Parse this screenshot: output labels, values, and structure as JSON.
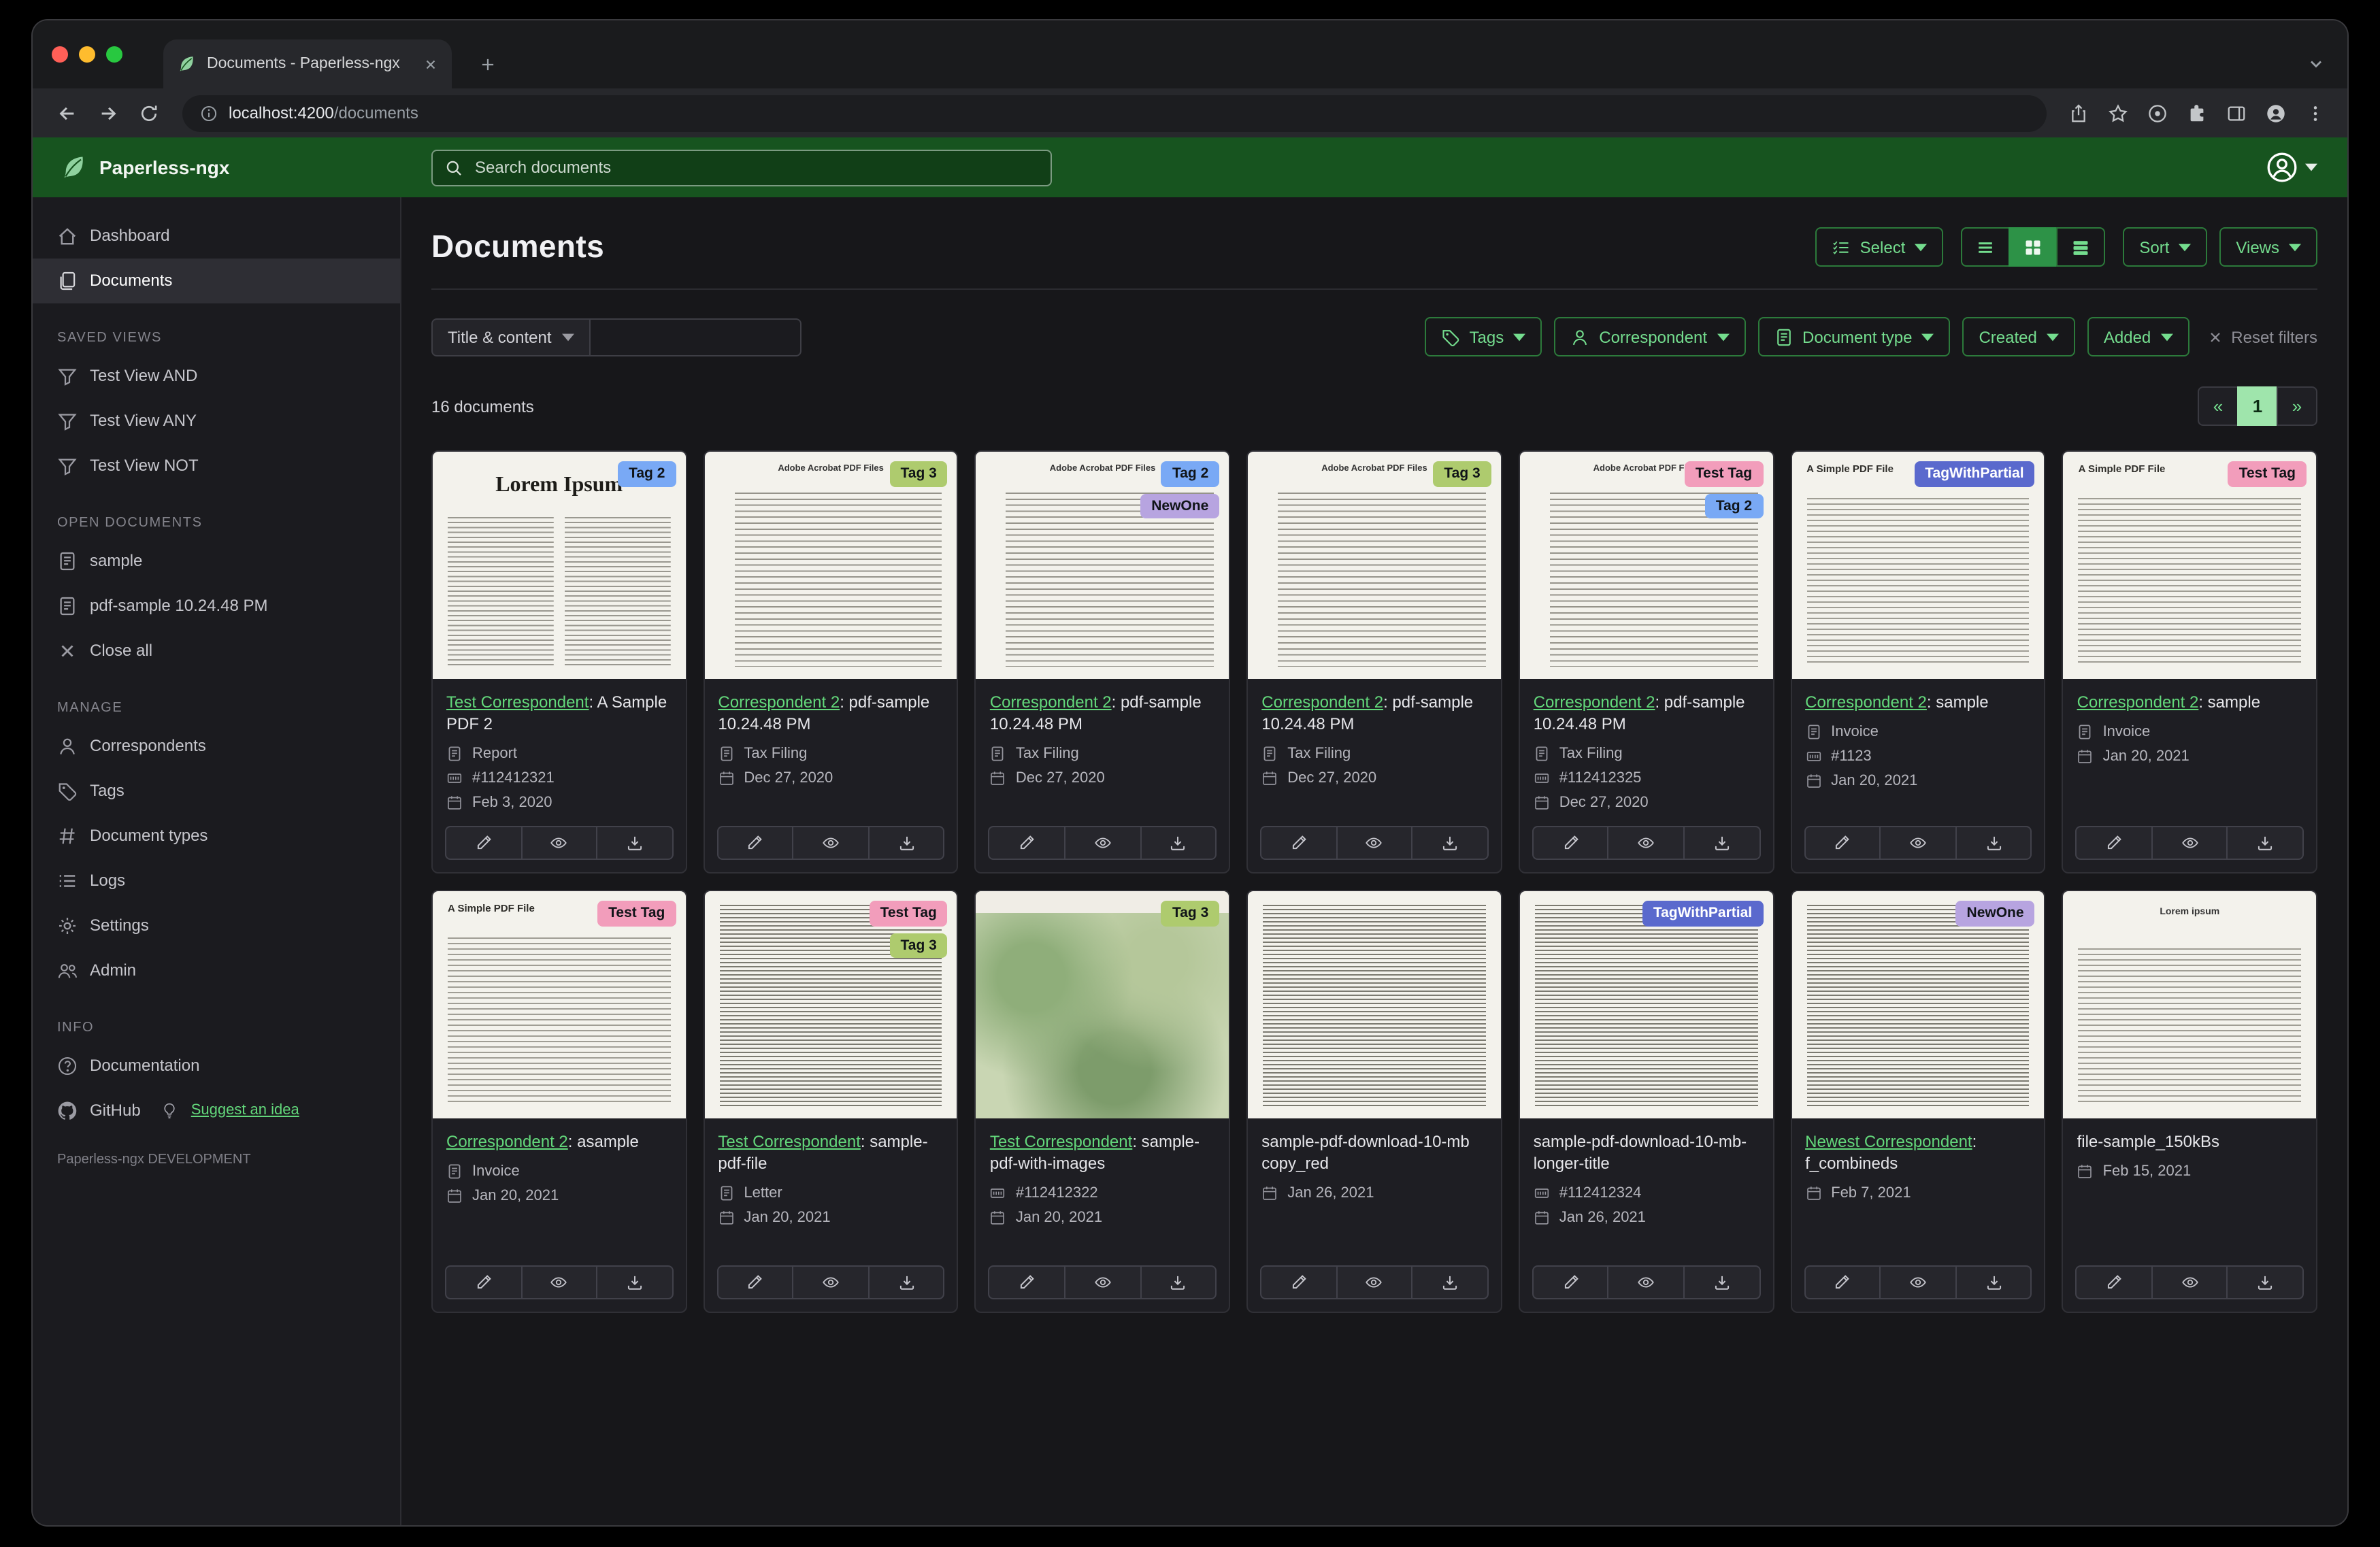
{
  "browser": {
    "tab_title": "Documents - Paperless-ngx",
    "url_host": "localhost:4200",
    "url_path": "/documents"
  },
  "header": {
    "brand": "Paperless-ngx",
    "search_placeholder": "Search documents"
  },
  "sidebar": {
    "sections": [
      {
        "heading": "",
        "items": [
          {
            "label": "Dashboard",
            "icon": "house"
          },
          {
            "label": "Documents",
            "icon": "files",
            "active": true
          }
        ]
      },
      {
        "heading": "SAVED VIEWS",
        "items": [
          {
            "label": "Test View AND",
            "icon": "funnel"
          },
          {
            "label": "Test View ANY",
            "icon": "funnel"
          },
          {
            "label": "Test View NOT",
            "icon": "funnel"
          }
        ]
      },
      {
        "heading": "OPEN DOCUMENTS",
        "items": [
          {
            "label": "sample",
            "icon": "filetext"
          },
          {
            "label": "pdf-sample 10.24.48 PM",
            "icon": "filetext"
          },
          {
            "label": "Close all",
            "icon": "close"
          }
        ]
      },
      {
        "heading": "MANAGE",
        "items": [
          {
            "label": "Correspondents",
            "icon": "person"
          },
          {
            "label": "Tags",
            "icon": "tag"
          },
          {
            "label": "Document types",
            "icon": "hash"
          },
          {
            "label": "Logs",
            "icon": "list"
          },
          {
            "label": "Settings",
            "icon": "gear"
          },
          {
            "label": "Admin",
            "icon": "people"
          }
        ]
      },
      {
        "heading": "INFO",
        "items": [
          {
            "label": "Documentation",
            "icon": "question"
          }
        ]
      }
    ],
    "github_label": "GitHub",
    "suggest_label": "Suggest an idea",
    "footer": "Paperless-ngx DEVELOPMENT"
  },
  "main": {
    "title": "Documents",
    "select_label": "Select",
    "sort_label": "Sort",
    "views_label": "Views"
  },
  "filters": {
    "title_content_label": "Title & content",
    "buttons": [
      {
        "label": "Tags",
        "icon": "tag"
      },
      {
        "label": "Correspondent",
        "icon": "person"
      },
      {
        "label": "Document type",
        "icon": "filetext"
      },
      {
        "label": "Created",
        "icon": ""
      },
      {
        "label": "Added",
        "icon": ""
      }
    ],
    "reset_label": "Reset filters"
  },
  "results": {
    "count": "16 documents",
    "prev": "«",
    "page": "1",
    "next": "»"
  },
  "tag_colors": {
    "blue": {
      "bg": "#79a9f5",
      "fg": "#101418"
    },
    "green": {
      "bg": "#aecb6e",
      "fg": "#101418"
    },
    "purple": {
      "bg": "#b7a4e0",
      "fg": "#101418"
    },
    "pink": {
      "bg": "#f29dbb",
      "fg": "#101418"
    },
    "indigo": {
      "bg": "#5a69cd",
      "fg": "#ffffff"
    }
  },
  "cards": [
    {
      "tags": [
        {
          "label": "Tag 2",
          "color": "blue"
        }
      ],
      "link": "Test Correspondent",
      "rest": ": A Sample PDF 2",
      "title": "",
      "meta": [
        {
          "icon": "filetext",
          "text": "Report"
        },
        {
          "icon": "asn",
          "text": "#112412321"
        },
        {
          "icon": "calendar",
          "text": "Feb 3, 2020"
        }
      ],
      "thumb": {
        "variant": "twocol",
        "heading": "Lorem Ipsum"
      }
    },
    {
      "tags": [
        {
          "label": "Tag 3",
          "color": "green"
        }
      ],
      "link": "Correspondent 2",
      "rest": ": pdf-sample 10.24.48 PM",
      "title": "",
      "meta": [
        {
          "icon": "filetext",
          "text": "Tax Filing"
        },
        {
          "icon": "calendar",
          "text": "Dec 27, 2020"
        }
      ],
      "thumb": {
        "variant": "bullets",
        "heading": "Adobe Acrobat PDF Files"
      }
    },
    {
      "tags": [
        {
          "label": "Tag 2",
          "color": "blue"
        },
        {
          "label": "NewOne",
          "color": "purple"
        }
      ],
      "link": "Correspondent 2",
      "rest": ": pdf-sample 10.24.48 PM",
      "title": "",
      "meta": [
        {
          "icon": "filetext",
          "text": "Tax Filing"
        },
        {
          "icon": "calendar",
          "text": "Dec 27, 2020"
        }
      ],
      "thumb": {
        "variant": "bullets",
        "heading": "Adobe Acrobat PDF Files"
      }
    },
    {
      "tags": [
        {
          "label": "Tag 3",
          "color": "green"
        }
      ],
      "link": "Correspondent 2",
      "rest": ": pdf-sample 10.24.48 PM",
      "title": "",
      "meta": [
        {
          "icon": "filetext",
          "text": "Tax Filing"
        },
        {
          "icon": "calendar",
          "text": "Dec 27, 2020"
        }
      ],
      "thumb": {
        "variant": "bullets",
        "heading": "Adobe Acrobat PDF Files"
      }
    },
    {
      "tags": [
        {
          "label": "Test Tag",
          "color": "pink"
        },
        {
          "label": "Tag 2",
          "color": "blue"
        }
      ],
      "link": "Correspondent 2",
      "rest": ": pdf-sample 10.24.48 PM",
      "title": "",
      "meta": [
        {
          "icon": "filetext",
          "text": "Tax Filing"
        },
        {
          "icon": "asn",
          "text": "#112412325"
        },
        {
          "icon": "calendar",
          "text": "Dec 27, 2020"
        }
      ],
      "thumb": {
        "variant": "bullets",
        "heading": "Adobe Acrobat PDF Files"
      }
    },
    {
      "tags": [
        {
          "label": "TagWithPartial",
          "color": "indigo"
        }
      ],
      "link": "Correspondent 2",
      "rest": ": sample",
      "title": "",
      "meta": [
        {
          "icon": "filetext",
          "text": "Invoice"
        },
        {
          "icon": "asn",
          "text": "#1123"
        },
        {
          "icon": "calendar",
          "text": "Jan 20, 2021"
        }
      ],
      "thumb": {
        "variant": "plain",
        "heading": "A Simple PDF File"
      }
    },
    {
      "tags": [
        {
          "label": "Test Tag",
          "color": "pink"
        }
      ],
      "link": "Correspondent 2",
      "rest": ": sample",
      "title": "",
      "meta": [
        {
          "icon": "filetext",
          "text": "Invoice"
        },
        {
          "icon": "calendar",
          "text": "Jan 20, 2021"
        }
      ],
      "thumb": {
        "variant": "plain",
        "heading": "A Simple PDF File"
      }
    },
    {
      "tags": [
        {
          "label": "Test Tag",
          "color": "pink"
        }
      ],
      "link": "Correspondent 2",
      "rest": ": asample",
      "title": "",
      "meta": [
        {
          "icon": "filetext",
          "text": "Invoice"
        },
        {
          "icon": "calendar",
          "text": "Jan 20, 2021"
        }
      ],
      "thumb": {
        "variant": "plain",
        "heading": "A Simple PDF File"
      }
    },
    {
      "tags": [
        {
          "label": "Test Tag",
          "color": "pink"
        },
        {
          "label": "Tag 3",
          "color": "green"
        }
      ],
      "link": "Test Correspondent",
      "rest": ": sample-pdf-file",
      "title": "",
      "meta": [
        {
          "icon": "filetext",
          "text": "Letter"
        },
        {
          "icon": "calendar",
          "text": "Jan 20, 2021"
        }
      ],
      "thumb": {
        "variant": "dense",
        "heading": ""
      }
    },
    {
      "tags": [
        {
          "label": "Tag 3",
          "color": "green"
        }
      ],
      "link": "Test Correspondent",
      "rest": ": sample-pdf-with-images",
      "title": "",
      "meta": [
        {
          "icon": "asn",
          "text": "#112412322"
        },
        {
          "icon": "calendar",
          "text": "Jan 20, 2021"
        }
      ],
      "thumb": {
        "variant": "map",
        "heading": ""
      }
    },
    {
      "tags": [],
      "link": "",
      "rest": "",
      "title": "sample-pdf-download-10-mb copy_red",
      "meta": [
        {
          "icon": "calendar",
          "text": "Jan 26, 2021"
        }
      ],
      "thumb": {
        "variant": "dense",
        "heading": ""
      }
    },
    {
      "tags": [
        {
          "label": "TagWithPartial",
          "color": "indigo"
        }
      ],
      "link": "",
      "rest": "",
      "title": "sample-pdf-download-10-mb-longer-title",
      "meta": [
        {
          "icon": "asn",
          "text": "#112412324"
        },
        {
          "icon": "calendar",
          "text": "Jan 26, 2021"
        }
      ],
      "thumb": {
        "variant": "dense",
        "heading": ""
      }
    },
    {
      "tags": [
        {
          "label": "NewOne",
          "color": "purple"
        }
      ],
      "link": "Newest Correspondent",
      "rest": ": f_combineds",
      "title": "",
      "meta": [
        {
          "icon": "calendar",
          "text": "Feb 7, 2021"
        }
      ],
      "thumb": {
        "variant": "dense",
        "heading": ""
      }
    },
    {
      "tags": [],
      "link": "",
      "rest": "",
      "title": "file-sample_150kBs",
      "meta": [
        {
          "icon": "calendar",
          "text": "Feb 15, 2021"
        }
      ],
      "thumb": {
        "variant": "centered",
        "heading": "Lorem ipsum"
      }
    }
  ]
}
